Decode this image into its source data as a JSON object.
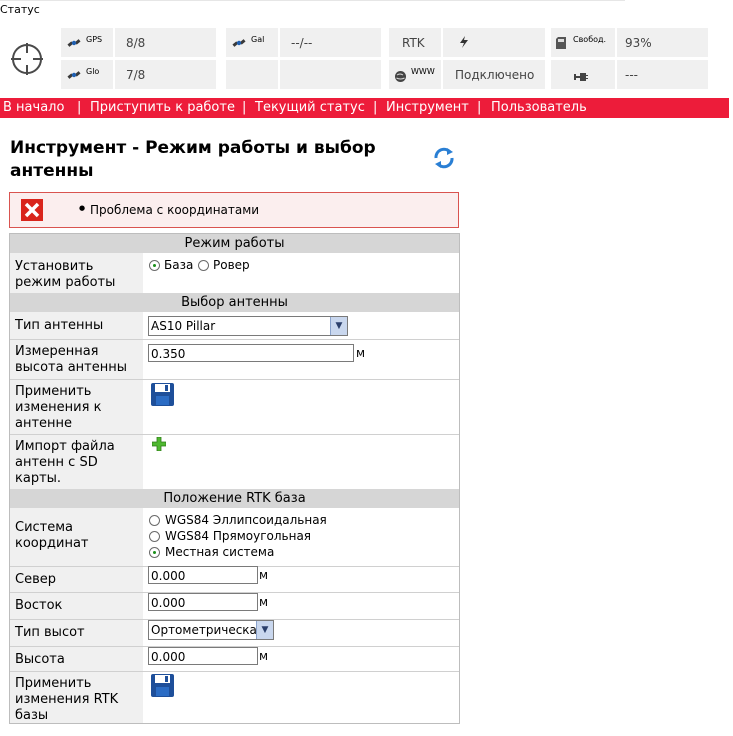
{
  "status": {
    "title": "Статус",
    "gps_label": "GPS",
    "gps_value": "8/8",
    "gal_label": "Gal",
    "gal_value": "--/--",
    "rtk_label": "RTK",
    "sd_label": "Свобод.",
    "sd_value": "93%",
    "glo_label": "Glo",
    "glo_value": "7/8",
    "www_label": "WWW",
    "www_value": "Подключено",
    "power_value": "---"
  },
  "nav": {
    "items": [
      "В начало",
      "Приступить к работе",
      "Текущий статус",
      "Инструмент",
      "Пользователь"
    ],
    "separator": "|"
  },
  "page": {
    "title": "Инструмент - Режим работы и выбор антенны"
  },
  "error": {
    "message": "Проблема с координатами"
  },
  "mode_section": {
    "header": "Режим работы",
    "label": "Установить режим работы",
    "options": [
      "База",
      "Ровер"
    ],
    "selected": "База"
  },
  "antenna_section": {
    "header": "Выбор антенны",
    "type_label": "Тип антенны",
    "type_value": "AS10 Pillar",
    "height_label": "Измеренная высота антенны",
    "height_value": "0.350",
    "height_unit": "м",
    "apply_label": "Применить изменения к антенне",
    "import_label": "Импорт файла антенн с SD карты."
  },
  "rtk_section": {
    "header": "Положение RTK база",
    "coord_label": "Система координат",
    "coord_options": [
      "WGS84 Эллипсоидальная",
      "WGS84 Прямоугольная",
      "Местная система"
    ],
    "coord_selected": "Местная система",
    "north_label": "Север",
    "north_value": "0.000",
    "east_label": "Восток",
    "east_value": "0.000",
    "height_type_label": "Тип высот",
    "height_type_value": "Ортометрическая",
    "height_label": "Высота",
    "height_value": "0.000",
    "unit": "м",
    "apply_label": "Применить изменения RTK базы"
  },
  "colors": {
    "nav_bg": "#ed1c3a",
    "error_border": "#d9534f",
    "section_bg": "#d6d6d6"
  }
}
